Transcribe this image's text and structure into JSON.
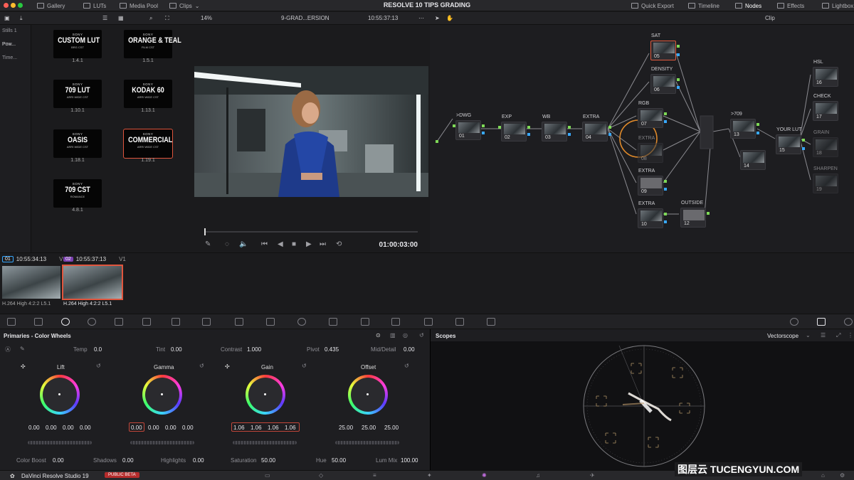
{
  "topbar": {
    "tabs": [
      "Gallery",
      "LUTs",
      "Media Pool",
      "Clips"
    ],
    "title": "RESOLVE 10 TIPS GRADING",
    "right": [
      "Quick Export",
      "Timeline",
      "Nodes",
      "Effects",
      "Lightbox"
    ]
  },
  "subbar": {
    "zoom": "14%",
    "clip_name": "9-GRAD...ERSION",
    "timecode": "10:55:37:13",
    "mode": "Clip"
  },
  "leftnav": [
    "Stills 1",
    "Pow...",
    "Time..."
  ],
  "stills": [
    {
      "brand": "SONY",
      "name": "CUSTOM LUT",
      "sub": "BRG CST",
      "ver": "1.4.1"
    },
    {
      "brand": "SONY",
      "name": "ORANGE & TEAL",
      "sub": "FILM CST",
      "ver": "1.5.1"
    },
    {
      "brand": "SONY",
      "name": "709 LUT",
      "sub": "ARRI WIDE CST",
      "ver": "1.10.1"
    },
    {
      "brand": "SONY",
      "name": "KODAK 60",
      "sub": "ARRI WIDE CST",
      "ver": "1.13.1"
    },
    {
      "brand": "SONY",
      "name": "OASIS",
      "sub": "ARRI WIDE CST",
      "ver": "1.18.1"
    },
    {
      "brand": "SONY",
      "name": "COMMERCIAL",
      "sub": "ARRI WIDE CST",
      "ver": "1.19.1"
    },
    {
      "brand": "SONY",
      "name": "709 CST",
      "sub": "ROMANCE",
      "ver": "4.8.1"
    }
  ],
  "viewer": {
    "timecode": "01:00:03:00"
  },
  "nodes": [
    {
      "label": ">DWG",
      "num": "01"
    },
    {
      "label": "EXP",
      "num": "02"
    },
    {
      "label": "WB",
      "num": "03"
    },
    {
      "label": "EXTRA",
      "num": "04"
    },
    {
      "label": "SAT",
      "num": "05"
    },
    {
      "label": "DENSITY",
      "num": "06"
    },
    {
      "label": "RGB",
      "num": "07"
    },
    {
      "label": "EXTRA",
      "num": "08"
    },
    {
      "label": "EXTRA",
      "num": "09"
    },
    {
      "label": "EXTRA",
      "num": "10"
    },
    {
      "label": "OUTSIDE",
      "num": "12"
    },
    {
      "label": ">709",
      "num": "13"
    },
    {
      "label": "",
      "num": "14"
    },
    {
      "label": "YOUR LUT",
      "num": "15"
    },
    {
      "label": "HSL",
      "num": "16"
    },
    {
      "label": "CHECK",
      "num": "17"
    },
    {
      "label": "GRAIN",
      "num": "18"
    },
    {
      "label": "SHARPEN",
      "num": "19"
    }
  ],
  "clips": [
    {
      "num": "01",
      "tc": "10:55:34:13",
      "track": "V1",
      "codec": "H.264 High 4:2:2 L5.1"
    },
    {
      "num": "02",
      "tc": "10:55:37:13",
      "track": "V1",
      "codec": "H.264 High 4:2:2 L5.1"
    }
  ],
  "primaries": {
    "title": "Primaries - Color Wheels",
    "params": {
      "temp_label": "Temp",
      "temp": "0.0",
      "tint_label": "Tint",
      "tint": "0.00",
      "contrast_label": "Contrast",
      "contrast": "1.000",
      "pivot_label": "Pivot",
      "pivot": "0.435",
      "middetail_label": "Mid/Detail",
      "middetail": "0.00"
    },
    "wheels": [
      {
        "name": "Lift",
        "vals": [
          "0.00",
          "0.00",
          "0.00",
          "0.00"
        ]
      },
      {
        "name": "Gamma",
        "vals": [
          "0.00",
          "0.00",
          "0.00",
          "0.00"
        ]
      },
      {
        "name": "Gain",
        "vals": [
          "1.06",
          "1.06",
          "1.06",
          "1.06"
        ]
      },
      {
        "name": "Offset",
        "vals": [
          "25.00",
          "25.00",
          "25.00"
        ]
      }
    ],
    "bottom": {
      "color_boost_label": "Color Boost",
      "color_boost": "0.00",
      "shadows_label": "Shadows",
      "shadows": "0.00",
      "highlights_label": "Highlights",
      "highlights": "0.00",
      "saturation_label": "Saturation",
      "saturation": "50.00",
      "hue_label": "Hue",
      "hue": "50.00",
      "lummix_label": "Lum Mix",
      "lummix": "100.00"
    }
  },
  "scopes": {
    "title": "Scopes",
    "type": "Vectorscope"
  },
  "bottom": {
    "app": "DaVinci Resolve Studio 19",
    "badge": "PUBLIC BETA",
    "watermark": "图层云  TUCENGYUN.COM"
  },
  "colors": {
    "accent": "#e0553d",
    "port_green": "#7ed957",
    "port_blue": "#39a9ff"
  }
}
